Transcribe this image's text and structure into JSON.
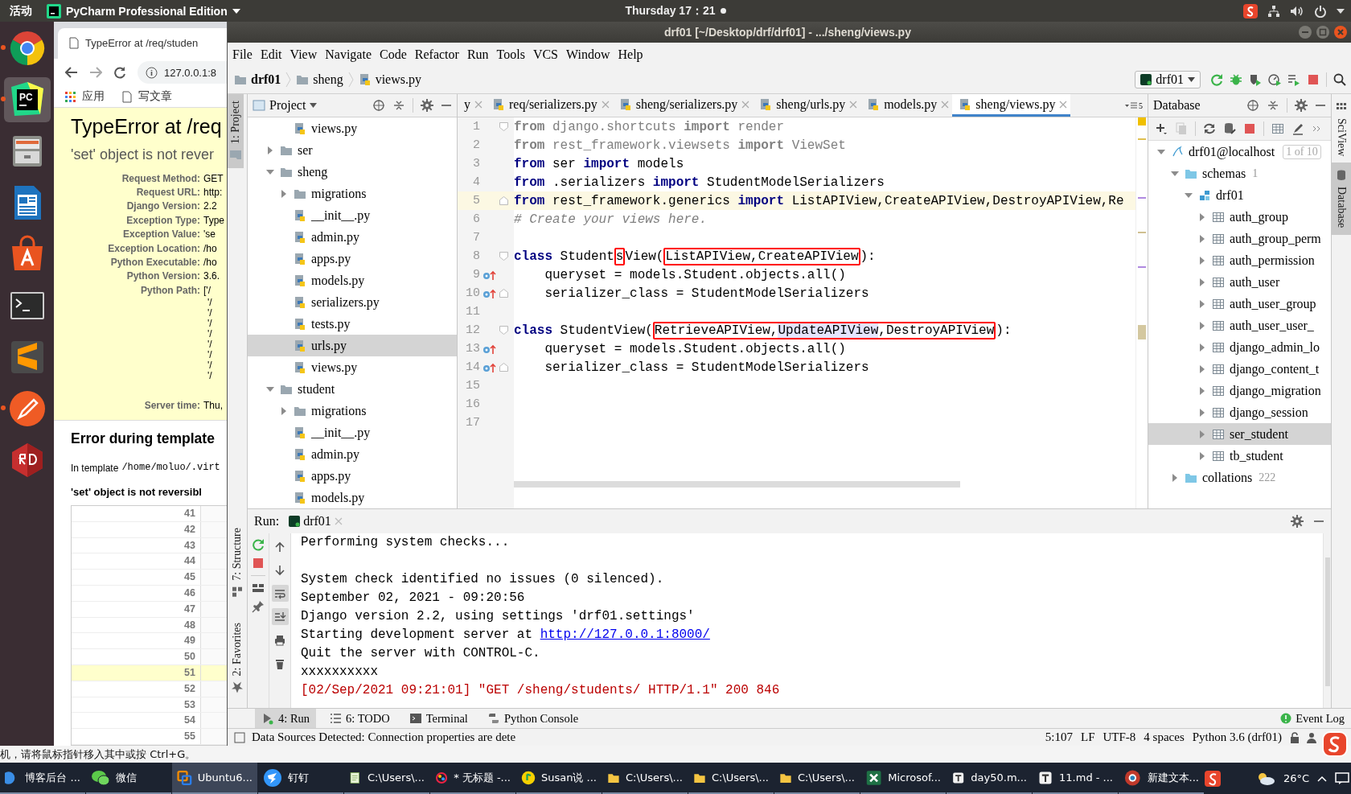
{
  "topbar": {
    "activities": "活动",
    "app": "PyCharm Professional Edition",
    "clock": "Thursday 17：21"
  },
  "dock": [
    {
      "kind": "chrome",
      "running": true,
      "selected": false
    },
    {
      "kind": "pycharm",
      "logo_text": "PC",
      "running": true,
      "selected": true
    },
    {
      "kind": "files",
      "running": false,
      "selected": false
    },
    {
      "kind": "writer",
      "running": false,
      "selected": false
    },
    {
      "kind": "software",
      "running": false,
      "selected": false
    },
    {
      "kind": "terminal",
      "running": false,
      "selected": false
    },
    {
      "kind": "sublime",
      "running": false,
      "selected": false
    },
    {
      "kind": "postman",
      "running": true,
      "selected": false
    },
    {
      "kind": "rdm",
      "running": false,
      "selected": false
    }
  ],
  "browser": {
    "tab_title": "TypeError at /req/studen",
    "url": "127.0.0.1:8",
    "bookmarks": [
      "应用",
      "写文章"
    ],
    "error_title": "TypeError at /req",
    "error_message": "'set' object is not rever",
    "meta": [
      {
        "label": "Request Method:",
        "value": "GET"
      },
      {
        "label": "Request URL:",
        "value": "http:"
      },
      {
        "label": "Django Version:",
        "value": "2.2"
      },
      {
        "label": "Exception Type:",
        "value": "Type"
      },
      {
        "label": "Exception Value:",
        "value": "'se"
      },
      {
        "label": "Exception Location:",
        "value": "/ho"
      },
      {
        "label": "Python Executable:",
        "value": "/ho"
      },
      {
        "label": "Python Version:",
        "value": "3.6."
      },
      {
        "label": "Python Path:",
        "value": "['/"
      }
    ],
    "path_lines": [
      "'/",
      "'/",
      "'/",
      "'/",
      "'/",
      "'/",
      "'/",
      "'/"
    ],
    "server_time": {
      "label": "Server time:",
      "value": "Thu,"
    },
    "template_heading": "Error during template",
    "template_note": {
      "text": "In template",
      "path": "/home/moluo/.virt"
    },
    "template_error": "'set' object is not reversibl",
    "source_lines": [
      {
        "number": "41",
        "highlighted": false
      },
      {
        "number": "42",
        "highlighted": false
      },
      {
        "number": "43",
        "highlighted": false
      },
      {
        "number": "44",
        "highlighted": false
      },
      {
        "number": "45",
        "highlighted": false
      },
      {
        "number": "46",
        "highlighted": false
      },
      {
        "number": "47",
        "highlighted": false
      },
      {
        "number": "48",
        "highlighted": false
      },
      {
        "number": "49",
        "highlighted": false
      },
      {
        "number": "50",
        "highlighted": false
      },
      {
        "number": "51",
        "highlighted": true
      },
      {
        "number": "52",
        "highlighted": false
      },
      {
        "number": "53",
        "highlighted": false
      },
      {
        "number": "54",
        "highlighted": false
      },
      {
        "number": "55",
        "highlighted": false
      }
    ]
  },
  "ide": {
    "title": "drf01 [~/Desktop/drf/drf01] - .../sheng/views.py",
    "menu": [
      "File",
      "Edit",
      "View",
      "Navigate",
      "Code",
      "Refactor",
      "Run",
      "Tools",
      "VCS",
      "Window",
      "Help"
    ],
    "breadcrumbs": [
      {
        "kind": "project",
        "label": "drf01"
      },
      {
        "kind": "folder",
        "label": "sheng"
      },
      {
        "kind": "file",
        "label": "views.py"
      }
    ],
    "run_config": "drf01",
    "left_strip": {
      "top": [
        {
          "kind": "project",
          "label": "1: Project",
          "selected": true
        }
      ],
      "bottom": [
        {
          "kind": "structure",
          "label": "7: Structure",
          "selected": false
        },
        {
          "kind": "favorites",
          "label": "2: Favorites",
          "selected": false
        }
      ]
    },
    "right_strip": [
      {
        "kind": "sciview",
        "label": "SciView",
        "selected": false
      },
      {
        "kind": "database",
        "label": "Database",
        "selected": true
      }
    ],
    "project": {
      "title": "Project",
      "scrolled_children": [
        {
          "kind": "file",
          "label": "views.py",
          "selected": false
        }
      ],
      "items": [
        {
          "kind": "folder",
          "label": "ser",
          "expanded": false,
          "selected": false
        },
        {
          "kind": "folder",
          "label": "sheng",
          "expanded": true,
          "selected": false,
          "children": [
            {
              "kind": "folder",
              "label": "migrations",
              "expanded": false,
              "selected": false
            },
            {
              "kind": "file",
              "label": "__init__.py",
              "selected": false
            },
            {
              "kind": "file",
              "label": "admin.py",
              "selected": false
            },
            {
              "kind": "file",
              "label": "apps.py",
              "selected": false
            },
            {
              "kind": "file",
              "label": "models.py",
              "selected": false
            },
            {
              "kind": "file",
              "label": "serializers.py",
              "selected": false
            },
            {
              "kind": "file",
              "label": "tests.py",
              "selected": false
            },
            {
              "kind": "file",
              "label": "urls.py",
              "selected": true
            },
            {
              "kind": "file",
              "label": "views.py",
              "selected": false
            }
          ]
        },
        {
          "kind": "folder",
          "label": "student",
          "expanded": true,
          "selected": false,
          "children": [
            {
              "kind": "folder",
              "label": "migrations",
              "expanded": false,
              "selected": false
            },
            {
              "kind": "file",
              "label": "__init__.py",
              "selected": false
            },
            {
              "kind": "file",
              "label": "admin.py",
              "selected": false
            },
            {
              "kind": "file",
              "label": "apps.py",
              "selected": false
            },
            {
              "kind": "file",
              "label": "models.py",
              "selected": false
            }
          ]
        }
      ]
    },
    "tabs": [
      {
        "kind": "partial",
        "label": "y",
        "selected": false
      },
      {
        "kind": "python",
        "label": "req/serializers.py",
        "selected": false
      },
      {
        "kind": "python",
        "label": "sheng/serializers.py",
        "selected": false
      },
      {
        "kind": "python",
        "label": "sheng/urls.py",
        "selected": false
      },
      {
        "kind": "python",
        "label": "models.py",
        "selected": false
      },
      {
        "kind": "python",
        "label": "sheng/views.py",
        "selected": true
      }
    ],
    "tab_overflow": "5",
    "code": [
      {
        "number": "1",
        "current": false,
        "overrides": false,
        "fold_start": true,
        "fold_end": false,
        "tokens": [
          {
            "kind": "faded-keyword",
            "text": "from"
          },
          {
            "kind": "faded",
            "text": " django.shortcuts "
          },
          {
            "kind": "faded-keyword",
            "text": "import"
          },
          {
            "kind": "faded",
            "text": " render"
          }
        ]
      },
      {
        "number": "2",
        "current": false,
        "overrides": false,
        "fold_start": false,
        "fold_end": false,
        "tokens": [
          {
            "kind": "faded-keyword",
            "text": "from"
          },
          {
            "kind": "faded",
            "text": " rest_framework.viewsets "
          },
          {
            "kind": "faded-keyword",
            "text": "import"
          },
          {
            "kind": "faded",
            "text": " ViewSet"
          }
        ]
      },
      {
        "number": "3",
        "current": false,
        "overrides": false,
        "fold_start": false,
        "fold_end": false,
        "tokens": [
          {
            "kind": "keyword",
            "text": "from"
          },
          {
            "kind": "plain",
            "text": " ser "
          },
          {
            "kind": "keyword",
            "text": "import"
          },
          {
            "kind": "plain",
            "text": " models"
          }
        ]
      },
      {
        "number": "4",
        "current": false,
        "overrides": false,
        "fold_start": false,
        "fold_end": false,
        "tokens": [
          {
            "kind": "keyword",
            "text": "from"
          },
          {
            "kind": "plain",
            "text": " .serializers "
          },
          {
            "kind": "keyword",
            "text": "import"
          },
          {
            "kind": "plain",
            "text": " StudentModelSerializers"
          }
        ]
      },
      {
        "number": "5",
        "current": true,
        "overrides": false,
        "fold_start": false,
        "fold_end": true,
        "tokens": [
          {
            "kind": "keyword",
            "text": "from"
          },
          {
            "kind": "plain",
            "text": " rest_framework.generics "
          },
          {
            "kind": "keyword",
            "text": "import"
          },
          {
            "kind": "plain",
            "text": " ListAPIView,CreateAPIView,DestroyAPIView,Re"
          }
        ]
      },
      {
        "number": "6",
        "current": false,
        "overrides": false,
        "fold_start": false,
        "fold_end": false,
        "tokens": [
          {
            "kind": "comment",
            "text": "# Create your views here."
          }
        ]
      },
      {
        "number": "7",
        "current": false,
        "overrides": false,
        "fold_start": false,
        "fold_end": false
      },
      {
        "number": "8",
        "current": false,
        "overrides": false,
        "fold_start": true,
        "fold_end": false,
        "tokens": [
          {
            "kind": "keyword",
            "text": "class"
          },
          {
            "kind": "plain",
            "text": " Student"
          },
          {
            "kind": "box",
            "parts": [
              {
                "kind": "plain",
                "text": "s"
              }
            ]
          },
          {
            "kind": "plain",
            "text": "View("
          },
          {
            "kind": "box",
            "parts": [
              {
                "kind": "plain",
                "text": "ListAPIView,CreateAPIView"
              }
            ]
          },
          {
            "kind": "plain",
            "text": "):"
          }
        ]
      },
      {
        "number": "9",
        "current": false,
        "overrides": true,
        "fold_start": false,
        "fold_end": false,
        "tokens": [
          {
            "kind": "plain",
            "text": "    queryset = models.Student.objects.all()"
          }
        ]
      },
      {
        "number": "10",
        "current": false,
        "overrides": true,
        "fold_start": false,
        "fold_end": true,
        "tokens": [
          {
            "kind": "plain",
            "text": "    serializer_class = StudentModelSerializers"
          }
        ]
      },
      {
        "number": "11",
        "current": false,
        "overrides": false,
        "fold_start": false,
        "fold_end": false
      },
      {
        "number": "12",
        "current": false,
        "overrides": false,
        "fold_start": true,
        "fold_end": false,
        "tokens": [
          {
            "kind": "keyword",
            "text": "class"
          },
          {
            "kind": "plain",
            "text": " StudentView("
          },
          {
            "kind": "box",
            "parts": [
              {
                "kind": "plain",
                "text": "RetrieveAPIView,"
              },
              {
                "kind": "match",
                "text": "UpdateAPIView"
              },
              {
                "kind": "plain",
                "text": ",DestroyAPIView"
              }
            ]
          },
          {
            "kind": "plain",
            "text": "):"
          }
        ]
      },
      {
        "number": "13",
        "current": false,
        "overrides": true,
        "fold_start": false,
        "fold_end": false,
        "tokens": [
          {
            "kind": "plain",
            "text": "    queryset = models.Student.objects.all()"
          }
        ]
      },
      {
        "number": "14",
        "current": false,
        "overrides": true,
        "fold_start": false,
        "fold_end": true,
        "tokens": [
          {
            "kind": "plain",
            "text": "    serializer_class = StudentModelSerializers"
          }
        ]
      },
      {
        "number": "15",
        "current": false,
        "overrides": false,
        "fold_start": false,
        "fold_end": false
      },
      {
        "number": "16",
        "current": false,
        "overrides": false,
        "fold_start": false,
        "fold_end": false
      },
      {
        "number": "17",
        "current": false,
        "overrides": false,
        "fold_start": false,
        "fold_end": false
      }
    ],
    "database": {
      "title": "Database",
      "tree": [
        {
          "kind": "connection",
          "label": "drf01@localhost",
          "badge": "1 of 10",
          "expanded": true,
          "selected": false,
          "children": [
            {
              "kind": "folder",
              "label": "schemas",
              "count": "1",
              "expanded": true,
              "selected": false,
              "children": [
                {
                  "kind": "schema",
                  "label": "drf01",
                  "expanded": true,
                  "selected": false,
                  "children": [
                    {
                      "kind": "table",
                      "label": "auth_group",
                      "expanded": false,
                      "selected": false
                    },
                    {
                      "kind": "table",
                      "label": "auth_group_perm",
                      "expanded": false,
                      "selected": false
                    },
                    {
                      "kind": "table",
                      "label": "auth_permission",
                      "expanded": false,
                      "selected": false
                    },
                    {
                      "kind": "table",
                      "label": "auth_user",
                      "expanded": false,
                      "selected": false
                    },
                    {
                      "kind": "table",
                      "label": "auth_user_group",
                      "expanded": false,
                      "selected": false
                    },
                    {
                      "kind": "table",
                      "label": "auth_user_user_",
                      "expanded": false,
                      "selected": false
                    },
                    {
                      "kind": "table",
                      "label": "django_admin_lo",
                      "expanded": false,
                      "selected": false
                    },
                    {
                      "kind": "table",
                      "label": "django_content_t",
                      "expanded": false,
                      "selected": false
                    },
                    {
                      "kind": "table",
                      "label": "django_migration",
                      "expanded": false,
                      "selected": false
                    },
                    {
                      "kind": "table",
                      "label": "django_session",
                      "expanded": false,
                      "selected": false
                    },
                    {
                      "kind": "table",
                      "label": "ser_student",
                      "expanded": false,
                      "selected": true
                    },
                    {
                      "kind": "table",
                      "label": "tb_student",
                      "expanded": false,
                      "selected": false
                    }
                  ]
                }
              ]
            },
            {
              "kind": "folder",
              "label": "collations",
              "count": "222",
              "expanded": false,
              "selected": false
            }
          ]
        }
      ]
    },
    "run": {
      "title": "Run:",
      "tab": "drf01",
      "tools": [
        {
          "kind": "up",
          "on": false
        },
        {
          "kind": "down",
          "on": false
        },
        {
          "kind": "wrap",
          "on": true
        },
        {
          "kind": "scroll-end",
          "on": true
        },
        {
          "kind": "print",
          "on": false
        },
        {
          "kind": "trash",
          "on": false
        }
      ],
      "lines": [
        {
          "kind": "plain",
          "text": "Performing system checks..."
        },
        {
          "kind": "blank"
        },
        {
          "kind": "plain",
          "text": "System check identified no issues (0 silenced)."
        },
        {
          "kind": "plain",
          "text": "September 02, 2021 - 09:20:56"
        },
        {
          "kind": "plain",
          "text": "Django version 2.2, using settings 'drf01.settings'"
        },
        {
          "kind": "link",
          "text": "Starting development server at ",
          "link": "http://127.0.0.1:8000/"
        },
        {
          "kind": "plain",
          "text": "Quit the server with CONTROL-C."
        },
        {
          "kind": "plain",
          "text": "xxxxxxxxxx"
        },
        {
          "kind": "error",
          "text": "[02/Sep/2021 09:21:01] \"GET /sheng/students/ HTTP/1.1\" 200 846"
        }
      ]
    },
    "tool_tabs": [
      {
        "kind": "run",
        "label": "4: Run",
        "selected": true
      },
      {
        "kind": "todo",
        "label": "6: TODO",
        "selected": false
      },
      {
        "kind": "terminal",
        "label": "Terminal",
        "selected": false
      },
      {
        "kind": "console",
        "label": "Python Console",
        "selected": false
      }
    ],
    "event_log": "Event Log",
    "status": {
      "message": "Data Sources Detected: Connection properties are dete",
      "fields": [
        "5:107",
        "LF",
        "UTF-8",
        "4 spaces",
        "Python 3.6 (drf01)"
      ]
    }
  },
  "hint": "机，请将鼠标指针移入其中或按 Ctrl+G。",
  "taskbar": {
    "items": [
      {
        "kind": "blog",
        "label": "博客后台 ...",
        "selected": false
      },
      {
        "kind": "chat",
        "label": "微信",
        "selected": false
      },
      {
        "kind": "vm",
        "label": "Ubuntu6...",
        "selected": true
      },
      {
        "kind": "ding",
        "label": "钉钉",
        "selected": false
      },
      {
        "kind": "notepad",
        "label": "C:\\Users\\...",
        "selected": false
      },
      {
        "kind": "paint",
        "label": "* 无标题 -...",
        "selected": false
      },
      {
        "kind": "music",
        "label": "Susan说 ...",
        "selected": false
      },
      {
        "kind": "folder",
        "label": "C:\\Users\\...",
        "selected": false
      },
      {
        "kind": "folder",
        "label": "C:\\Users\\...",
        "selected": false
      },
      {
        "kind": "folder",
        "label": "C:\\Users\\...",
        "selected": false
      },
      {
        "kind": "sheet",
        "label": "Microsof...",
        "selected": false
      },
      {
        "kind": "editor",
        "label": "day50.m...",
        "selected": false
      },
      {
        "kind": "editor",
        "label": "11.md - ...",
        "selected": false
      },
      {
        "kind": "web",
        "label": "新建文本...",
        "selected": false
      }
    ],
    "temperature": "26°C"
  }
}
